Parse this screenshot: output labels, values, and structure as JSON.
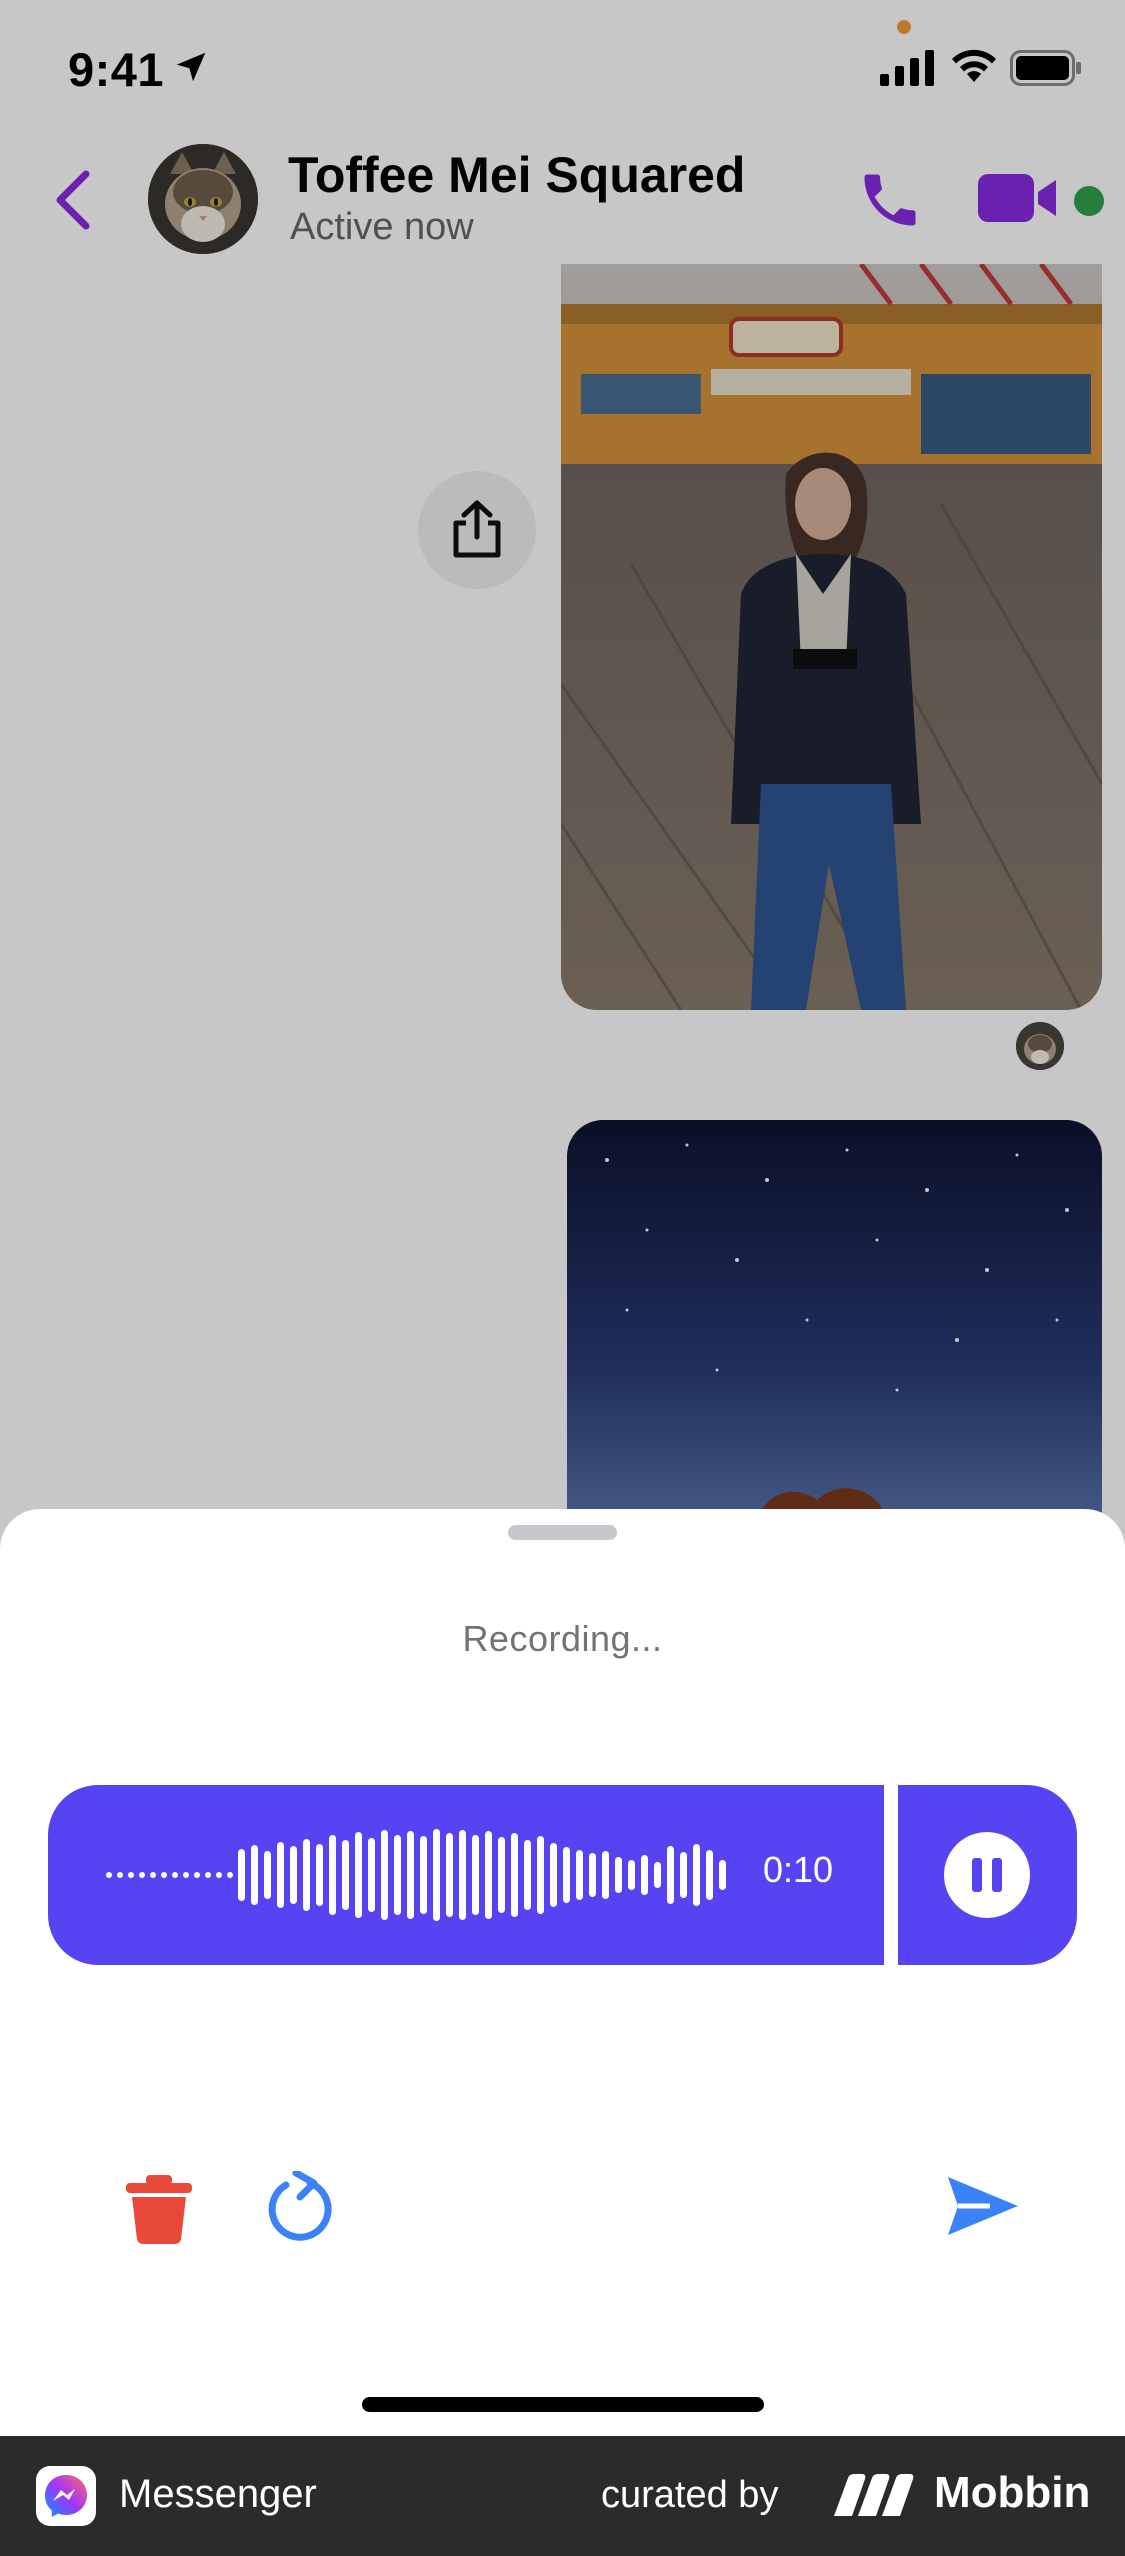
{
  "status_bar": {
    "time": "9:41",
    "icons": [
      "location-arrow-icon",
      "cellular-signal-icon",
      "wifi-icon",
      "battery-icon"
    ]
  },
  "header": {
    "contact_name": "Toffee Mei Squared",
    "contact_status": "Active now",
    "icons": [
      "back-chevron-icon",
      "phone-call-icon",
      "video-call-icon"
    ]
  },
  "messages": {
    "items": [
      {
        "type": "photo",
        "description_icon": "photo-boardwalk"
      },
      {
        "type": "photo",
        "description_icon": "photo-night-sky"
      }
    ]
  },
  "recording_sheet": {
    "status_label": "Recording...",
    "elapsed": "0:10",
    "actions": [
      "trash-icon",
      "refresh-icon",
      "send-icon",
      "pause-icon"
    ]
  },
  "footer": {
    "app_name": "Messenger",
    "curated_label": "curated by",
    "brand": "Mobbin"
  },
  "colors": {
    "accent_purple": "#8a2be2",
    "record_blue": "#5644f3",
    "send_blue": "#3b82f6",
    "trash_red": "#e8493a",
    "online_green": "#31a24c"
  }
}
